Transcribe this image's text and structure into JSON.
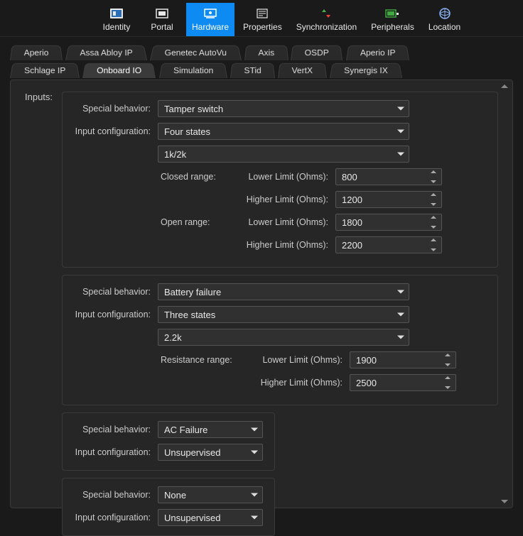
{
  "topnav": {
    "items": [
      {
        "label": "Identity"
      },
      {
        "label": "Portal"
      },
      {
        "label": "Hardware",
        "active": true
      },
      {
        "label": "Properties"
      },
      {
        "label": "Synchronization"
      },
      {
        "label": "Peripherals"
      },
      {
        "label": "Location"
      }
    ]
  },
  "tabs": {
    "row1": [
      {
        "label": "Aperio"
      },
      {
        "label": "Assa Abloy IP"
      },
      {
        "label": "Genetec AutoVu"
      },
      {
        "label": "Axis"
      },
      {
        "label": "OSDP"
      },
      {
        "label": "Aperio IP"
      }
    ],
    "row2": [
      {
        "label": "Schlage IP"
      },
      {
        "label": "Onboard IO",
        "active": true
      },
      {
        "label": "Simulation"
      },
      {
        "label": "STid"
      },
      {
        "label": "VertX"
      },
      {
        "label": "Synergis IX"
      }
    ]
  },
  "labels": {
    "inputs": "Inputs:",
    "special_behavior": "Special behavior:",
    "input_configuration": "Input configuration:",
    "closed_range": "Closed range:",
    "open_range": "Open range:",
    "resistance_range": "Resistance range:",
    "lower_limit": "Lower Limit (Ohms):",
    "higher_limit": "Higher Limit (Ohms):"
  },
  "groups": [
    {
      "special_behavior": "Tamper switch",
      "input_configuration": "Four states",
      "resistor": "1k/2k",
      "closed": {
        "lower": "800",
        "higher": "1200"
      },
      "open": {
        "lower": "1800",
        "higher": "2200"
      }
    },
    {
      "special_behavior": "Battery failure",
      "input_configuration": "Three states",
      "resistor": "2.2k",
      "resistance": {
        "lower": "1900",
        "higher": "2500"
      }
    },
    {
      "special_behavior": "AC Failure",
      "input_configuration": "Unsupervised"
    },
    {
      "special_behavior": "None",
      "input_configuration": "Unsupervised"
    }
  ]
}
